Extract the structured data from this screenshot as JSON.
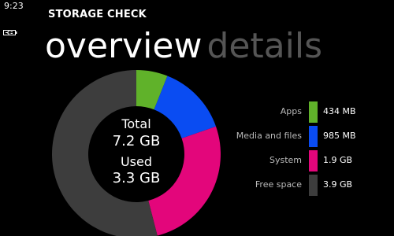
{
  "status_bar": {
    "time": "9:23",
    "battery_icon": "battery-charging-icon"
  },
  "app": {
    "title": "STORAGE CHECK"
  },
  "pivot": {
    "items": [
      {
        "label": "overview",
        "active": true
      },
      {
        "label": "details",
        "active": false
      }
    ]
  },
  "summary": {
    "total_label": "Total",
    "total_value": "7.2 GB",
    "used_label": "Used",
    "used_value": "3.3 GB"
  },
  "colors": {
    "apps": "#60b22a",
    "media": "#0a4cf2",
    "system": "#e3067b",
    "free": "#3d3d3d",
    "pivot_inactive": "#555555"
  },
  "legend": [
    {
      "label": "Apps",
      "value": "434 MB",
      "color": "#60b22a"
    },
    {
      "label": "Media and files",
      "value": "985 MB",
      "color": "#0a4cf2"
    },
    {
      "label": "System",
      "value": "1.9 GB",
      "color": "#e3067b"
    },
    {
      "label": "Free space",
      "value": "3.9 GB",
      "color": "#3d3d3d"
    }
  ],
  "chart_data": {
    "type": "pie",
    "categories": [
      "Apps",
      "Media and files",
      "System",
      "Free space"
    ],
    "values": [
      434,
      985,
      1900,
      3900
    ],
    "unit": "MB"
  }
}
